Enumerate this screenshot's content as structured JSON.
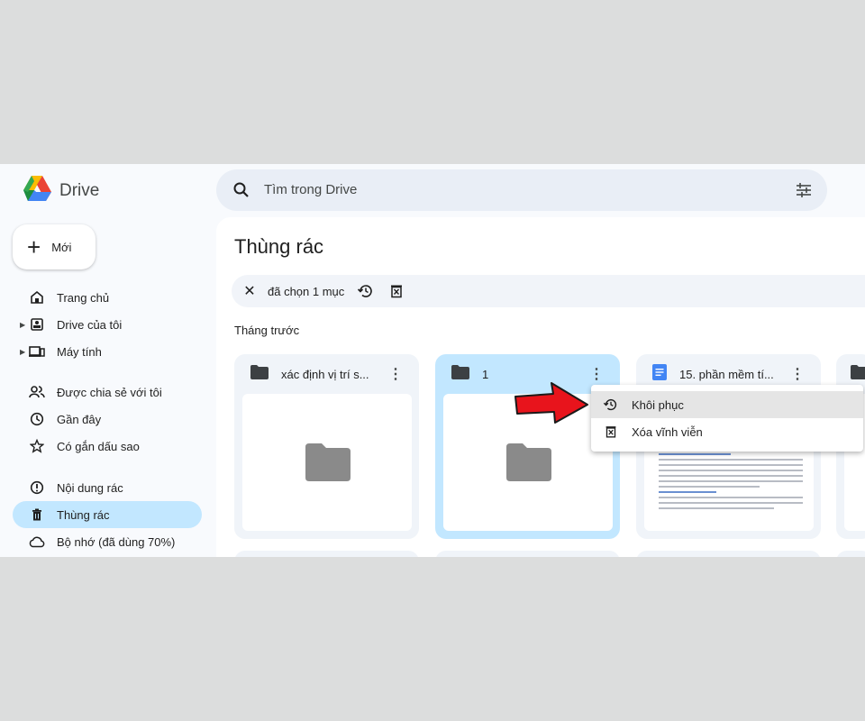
{
  "app": {
    "name": "Drive",
    "brand_colors": [
      "#34a853",
      "#fbbc04",
      "#4285f4",
      "#ea4335"
    ]
  },
  "search": {
    "placeholder": "Tìm trong Drive",
    "icon": "search-icon",
    "filter_icon": "tune-icon"
  },
  "sidebar": {
    "new_label": "Mới",
    "items": [
      {
        "label": "Trang chủ",
        "icon": "home-icon",
        "expandable": false,
        "active": false
      },
      {
        "label": "Drive của tôi",
        "icon": "my-drive-icon",
        "expandable": true,
        "active": false
      },
      {
        "label": "Máy tính",
        "icon": "computers-icon",
        "expandable": true,
        "active": false
      },
      {
        "label": "Được chia sẻ với tôi",
        "icon": "shared-icon",
        "expandable": false,
        "active": false
      },
      {
        "label": "Gần đây",
        "icon": "clock-icon",
        "expandable": false,
        "active": false
      },
      {
        "label": "Có gắn dấu sao",
        "icon": "star-icon",
        "expandable": false,
        "active": false
      },
      {
        "label": "Nội dung rác",
        "icon": "spam-icon",
        "expandable": false,
        "active": false
      },
      {
        "label": "Thùng rác",
        "icon": "trash-icon",
        "expandable": false,
        "active": true
      },
      {
        "label": "Bộ nhớ (đã dùng 70%)",
        "icon": "cloud-icon",
        "expandable": false,
        "active": false
      }
    ]
  },
  "main": {
    "title": "Thùng rác",
    "selection": {
      "count_label": "đã chọn 1 mục",
      "restore_icon": "restore-icon",
      "delete_icon": "delete-forever-icon"
    },
    "section": "Tháng trước",
    "files": [
      {
        "name": "xác định vị trí s...",
        "type": "folder",
        "selected": false
      },
      {
        "name": "1",
        "type": "folder",
        "selected": true
      },
      {
        "name": "15. phần mềm tí...",
        "type": "document",
        "selected": false
      }
    ]
  },
  "context_menu": {
    "items": [
      {
        "label": "Khôi phục",
        "icon": "restore-icon"
      },
      {
        "label": "Xóa vĩnh viễn",
        "icon": "delete-forever-icon"
      }
    ]
  },
  "colors": {
    "active_nav": "#c2e7ff",
    "selected_card": "#c2e7ff",
    "annotation_arrow": "#e8141c"
  }
}
